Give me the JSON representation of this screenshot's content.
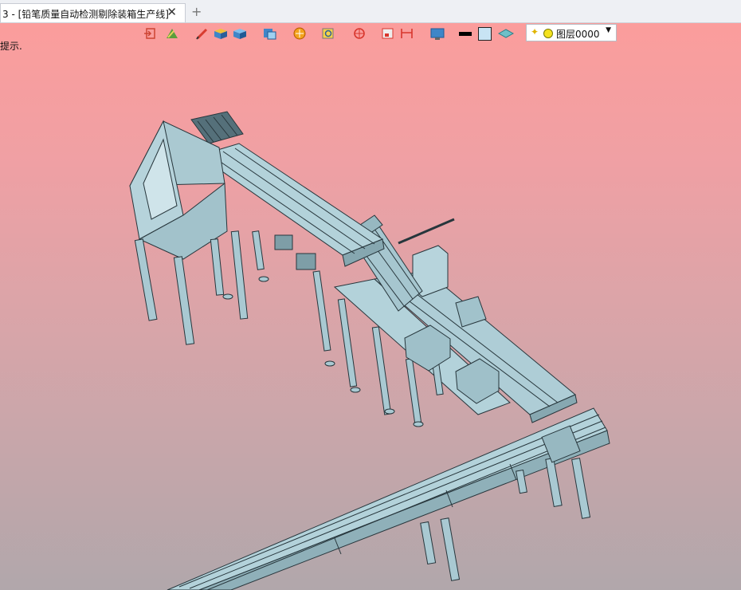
{
  "tabbar": {
    "tab_title": "3 - [铅笔质量自动检测剔除装箱生产线]",
    "close_glyph": "✕",
    "add_glyph": "+"
  },
  "viewport": {
    "hint_text": "提示.",
    "background_top": "#fb9d9c",
    "background_bottom": "#b1a7ab"
  },
  "toolbar": {
    "icons": [
      "exit-icon",
      "hatch-icon",
      "pencil-icon",
      "box-icon",
      "cube-icon",
      "view-cube-icon",
      "render-icon",
      "zoom-window-icon",
      "rotate-icon",
      "frame-icon",
      "dimension-icon",
      "display-icon",
      "line-color-swatch",
      "fill-color-swatch",
      "layer-tools-icon"
    ],
    "line_color": "#000000",
    "fill_color": "#c8e4f4"
  },
  "layer_selector": {
    "label": "图层0000",
    "bulb_glyph": "💡",
    "caret_glyph": "▼"
  },
  "model": {
    "color": "#a9c9d2",
    "edge_color": "#27363c"
  }
}
